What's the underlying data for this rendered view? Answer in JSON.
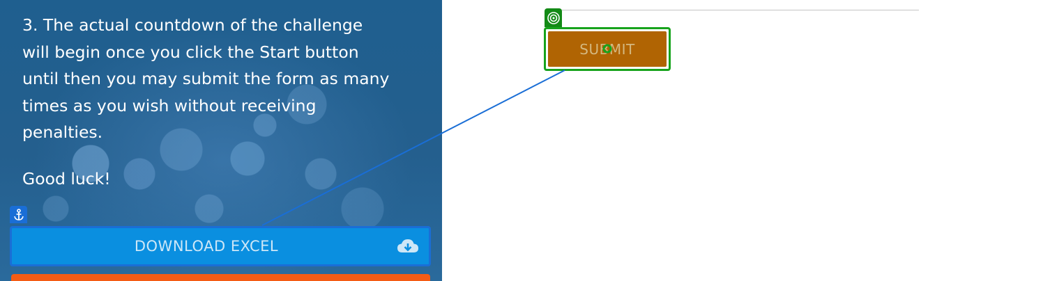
{
  "instructions": {
    "line1": "3. The actual countdown of the challenge",
    "line2": "will begin once you click the Start button",
    "line3": "until then you may submit the form as many",
    "line4": "times as you wish without receiving",
    "line5": "penalties.",
    "good_luck": "Good luck!"
  },
  "download_button": {
    "label": "DOWNLOAD EXCEL",
    "icon": "cloud-download-icon"
  },
  "submit_button": {
    "label": "SUBMIT"
  },
  "annotations": {
    "anchor_icon": "anchor-icon",
    "target_icon": "target-icon",
    "connector_color": "#1a6ed6",
    "target_color": "#138a16"
  },
  "colors": {
    "panel_blue": "#245f8e",
    "download_bg": "#0a8fe0",
    "submit_bg": "#b06403",
    "orange_button": "#f45c15"
  }
}
